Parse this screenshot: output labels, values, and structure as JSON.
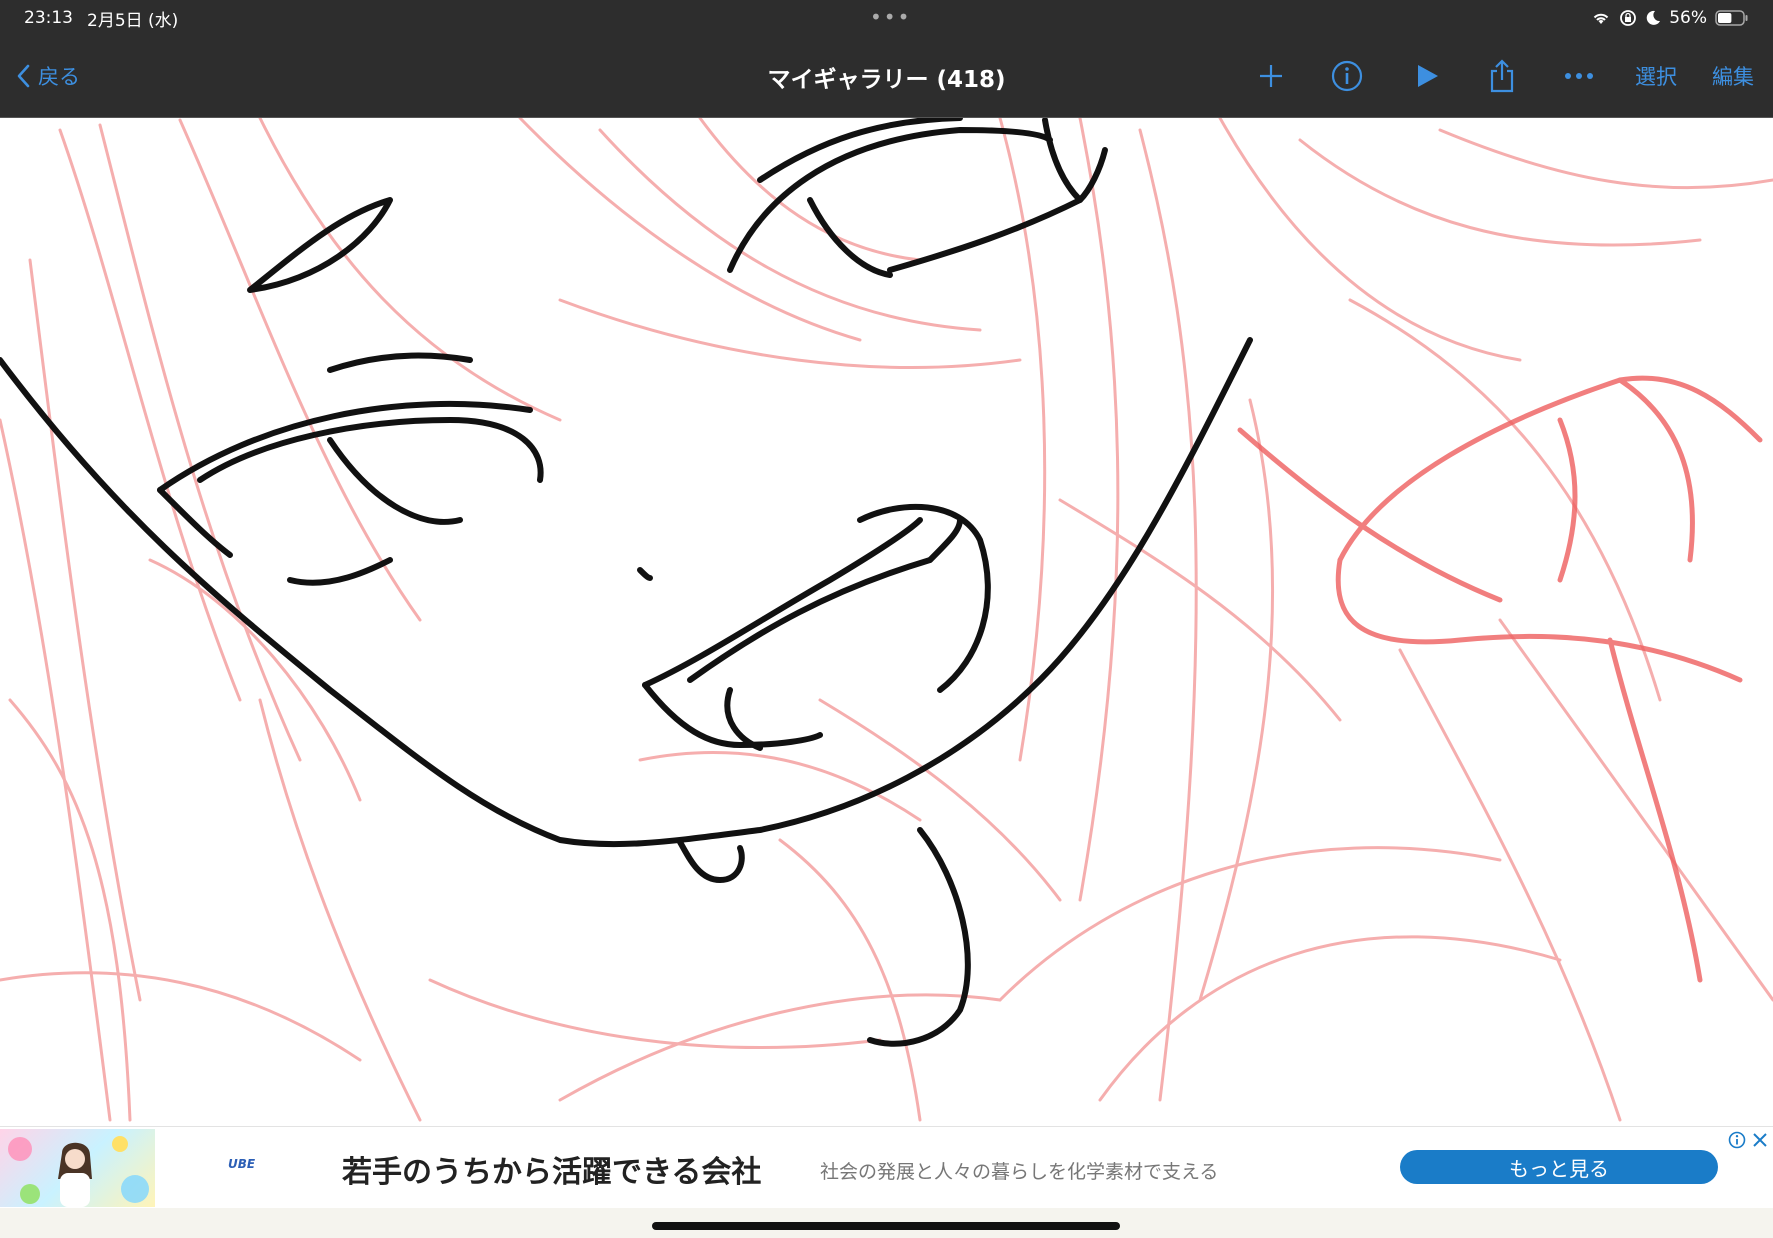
{
  "status_bar": {
    "time": "23:13",
    "date": "2月5日 (水)",
    "battery_percent": "56%",
    "battery_level": 0.56
  },
  "nav": {
    "back_label": "戻る",
    "title": "マイギャラリー (418)",
    "select_label": "選択",
    "edit_label": "編集",
    "icons": [
      "plus-icon",
      "info-icon",
      "play-icon",
      "share-icon",
      "more-icon"
    ]
  },
  "ad": {
    "logo_text": "UBE",
    "headline": "若手のうちから活躍できる会社",
    "description": "社会の発展と人々の暮らしを化学素材で支える",
    "button_label": "もっと見る"
  },
  "colors": {
    "topbar": "#2d2d2d",
    "accent": "#3d8fe0",
    "sketch_red": "#f08a8a",
    "line_art": "#111111",
    "ad_button": "#1a7cc8"
  }
}
